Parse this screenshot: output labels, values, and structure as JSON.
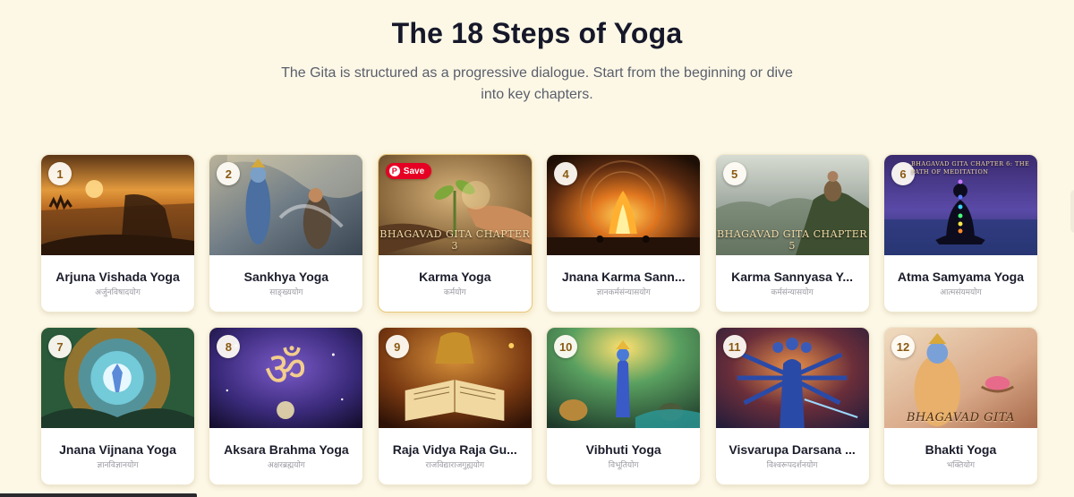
{
  "header": {
    "title": "The 18 Steps of Yoga",
    "subtitle": "The Gita is structured as a progressive dialogue. Start from the beginning or dive into key chapters."
  },
  "save_label": "Save",
  "chapters": [
    {
      "number": "1",
      "title": "Arjuna Vishada Yoga",
      "sanskrit": "अर्जुनविषादयोग"
    },
    {
      "number": "2",
      "title": "Sankhya Yoga",
      "sanskrit": "साङ्ख्ययोग"
    },
    {
      "number": "3",
      "title": "Karma Yoga",
      "sanskrit": "कर्मयोग",
      "overlay": "BHAGAVAD GITA CHAPTER 3"
    },
    {
      "number": "4",
      "title": "Jnana Karma Sann...",
      "sanskrit": "ज्ञानकर्मसंन्यासयोग"
    },
    {
      "number": "5",
      "title": "Karma Sannyasa Y...",
      "sanskrit": "कर्मसंन्यासयोग",
      "overlay": "BHAGAVAD GITA CHAPTER 5"
    },
    {
      "number": "6",
      "title": "Atma Samyama Yoga",
      "sanskrit": "आत्मसंयमयोग",
      "overlay": "BHAGAVAD GITA CHAPTER 6: THE PATH OF MEDITATION"
    },
    {
      "number": "7",
      "title": "Jnana Vijnana Yoga",
      "sanskrit": "ज्ञानविज्ञानयोग"
    },
    {
      "number": "8",
      "title": "Aksara Brahma Yoga",
      "sanskrit": "अक्षरब्रह्मयोग"
    },
    {
      "number": "9",
      "title": "Raja Vidya Raja Gu...",
      "sanskrit": "राजविद्याराजगुह्ययोग"
    },
    {
      "number": "10",
      "title": "Vibhuti Yoga",
      "sanskrit": "विभूतियोग"
    },
    {
      "number": "11",
      "title": "Visvarupa Darsana ...",
      "sanskrit": "विश्वरूपदर्शनयोग"
    },
    {
      "number": "12",
      "title": "Bhakti Yoga",
      "sanskrit": "भक्तियोग",
      "overlay": "BHAGAVAD GITA"
    }
  ],
  "colors": {
    "background": "#fdf8e6",
    "badge_text": "#8a5a12",
    "save_button": "#e60023"
  }
}
